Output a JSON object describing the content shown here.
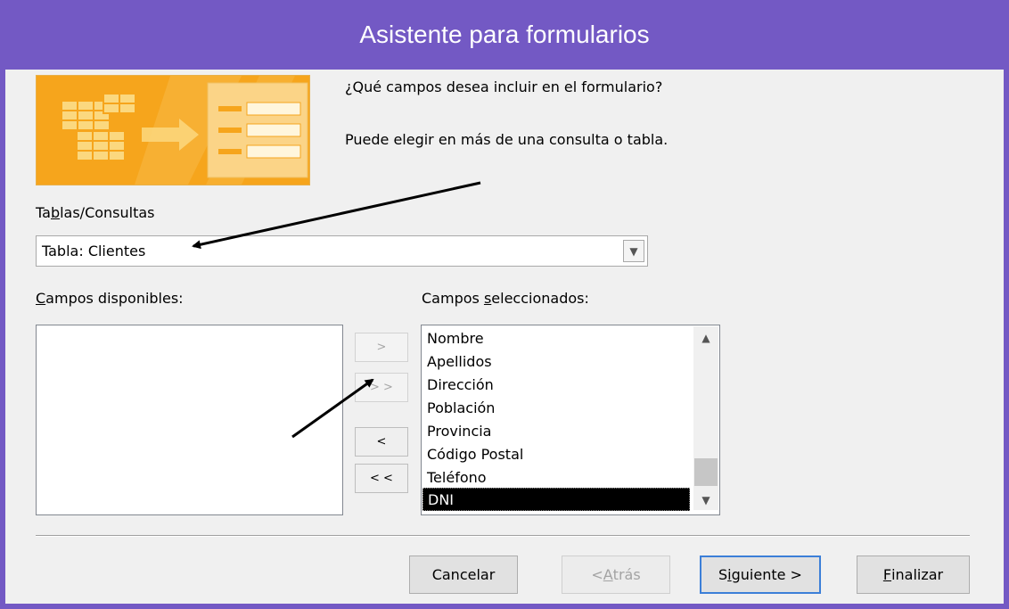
{
  "window": {
    "title": "Asistente para formularios"
  },
  "header": {
    "question": "¿Qué campos desea incluir en el formulario?",
    "hint": "Puede elegir en más de una consulta o tabla."
  },
  "tables_label": {
    "pre": "Ta",
    "accel": "b",
    "post": "las/Consultas"
  },
  "table_combo": {
    "value": "Tabla: Clientes"
  },
  "available": {
    "accel": "C",
    "post": "ampos disponibles:",
    "items": []
  },
  "selected": {
    "pre": "Campos ",
    "accel": "s",
    "post": "eleccionados:",
    "items": [
      "Nombre",
      "Apellidos",
      "Dirección",
      "Población",
      "Provincia",
      "Código Postal",
      "Teléfono",
      "DNI"
    ],
    "selected_item": "DNI"
  },
  "move_buttons": {
    "add": ">",
    "add_all": "> >",
    "remove": "<",
    "remove_all": "< <"
  },
  "footer": {
    "cancel": "Cancelar",
    "back": {
      "pre": "< ",
      "accel": "A",
      "post": "trás"
    },
    "next": {
      "pre": "S",
      "accel": "i",
      "post": "guiente >"
    },
    "finish": {
      "accel": "F",
      "post": "inalizar"
    }
  },
  "colors": {
    "titlebar": "#7359c4",
    "artwork": "#f6a51c",
    "selection": "#000000"
  }
}
